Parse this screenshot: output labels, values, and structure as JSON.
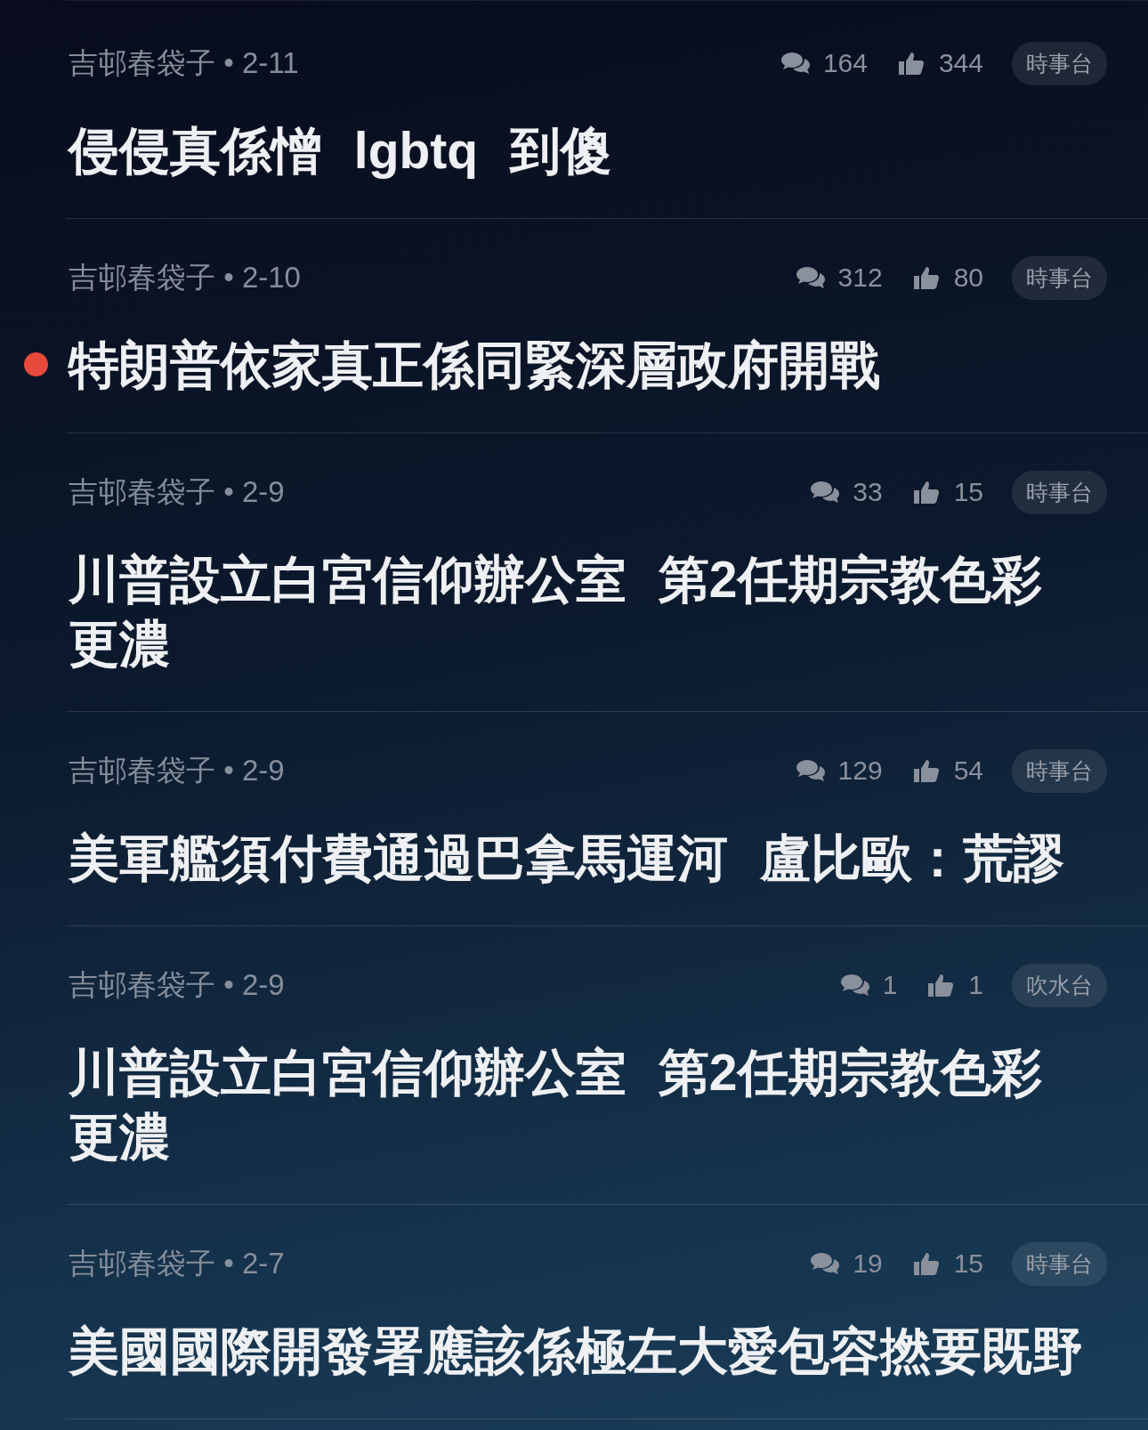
{
  "posts": [
    {
      "meta": "吉邨春袋子 • 2-11",
      "comments": "164",
      "likes": "344",
      "board": "時事台",
      "title": "侵侵真係憎 lgbtq 到傻",
      "unread": false
    },
    {
      "meta": "吉邨春袋子 • 2-10",
      "comments": "312",
      "likes": "80",
      "board": "時事台",
      "title": "特朗普依家真正係同緊深層政府開戰",
      "unread": true
    },
    {
      "meta": "吉邨春袋子 • 2-9",
      "comments": "33",
      "likes": "15",
      "board": "時事台",
      "title": "川普設立白宮信仰辦公室 第2任期宗教色彩更濃",
      "unread": false
    },
    {
      "meta": "吉邨春袋子 • 2-9",
      "comments": "129",
      "likes": "54",
      "board": "時事台",
      "title": "美軍艦須付費通過巴拿馬運河 盧比歐：荒謬",
      "unread": false
    },
    {
      "meta": "吉邨春袋子 • 2-9",
      "comments": "1",
      "likes": "1",
      "board": "吹水台",
      "title": "川普設立白宮信仰辦公室 第2任期宗教色彩更濃",
      "unread": false
    },
    {
      "meta": "吉邨春袋子 • 2-7",
      "comments": "19",
      "likes": "15",
      "board": "時事台",
      "title": "美國國際開發署應該係極左大愛包容撚要既野",
      "unread": false
    }
  ]
}
